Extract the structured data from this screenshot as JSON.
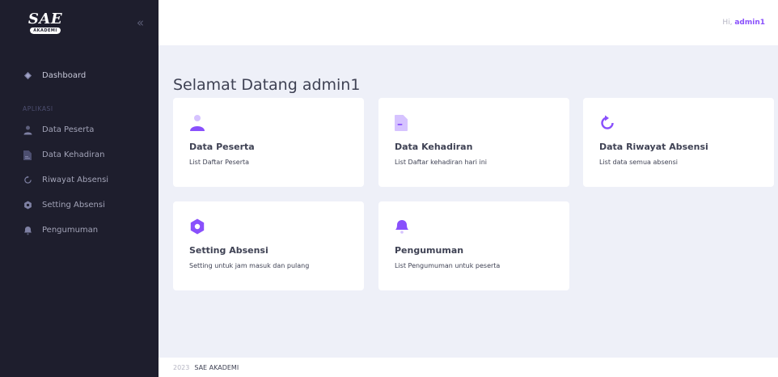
{
  "sidebar": {
    "logo": {
      "script": "SAE",
      "ribbon": "AKADEMI"
    },
    "collapse_glyph": "«",
    "dashboard_label": "Dashboard",
    "section_label": "APLIKASI",
    "items": [
      {
        "label": "Data Peserta",
        "icon": "user-icon"
      },
      {
        "label": "Data Kehadiran",
        "icon": "file-icon"
      },
      {
        "label": "Riwayat Absensi",
        "icon": "refresh-icon"
      },
      {
        "label": "Setting Absensi",
        "icon": "gear-icon"
      },
      {
        "label": "Pengumuman",
        "icon": "bell-icon"
      }
    ]
  },
  "header": {
    "greeting_prefix": "Hi,",
    "username": "admin1"
  },
  "main": {
    "title": "Selamat Datang admin1",
    "cards": [
      {
        "title": "Data Peserta",
        "desc": "List Daftar Peserta",
        "icon": "user-icon"
      },
      {
        "title": "Data Kehadiran",
        "desc": "List Daftar kehadiran hari ini",
        "icon": "file-icon"
      },
      {
        "title": "Data Riwayat Absensi",
        "desc": "List data semua absensi",
        "icon": "refresh-icon"
      },
      {
        "title": "Setting Absensi",
        "desc": "Setting untuk jam masuk dan pulang",
        "icon": "gear-icon"
      },
      {
        "title": "Pengumuman",
        "desc": "List Pengumuman untuk peserta",
        "icon": "bell-icon"
      }
    ]
  },
  "footer": {
    "year": "2023",
    "org": "SAE AKADEMI"
  },
  "colors": {
    "accent": "#8950fc",
    "accent_light": "#d6c3ff",
    "sidebar_bg": "#1e1e2d",
    "page_bg": "#eef0f8"
  }
}
